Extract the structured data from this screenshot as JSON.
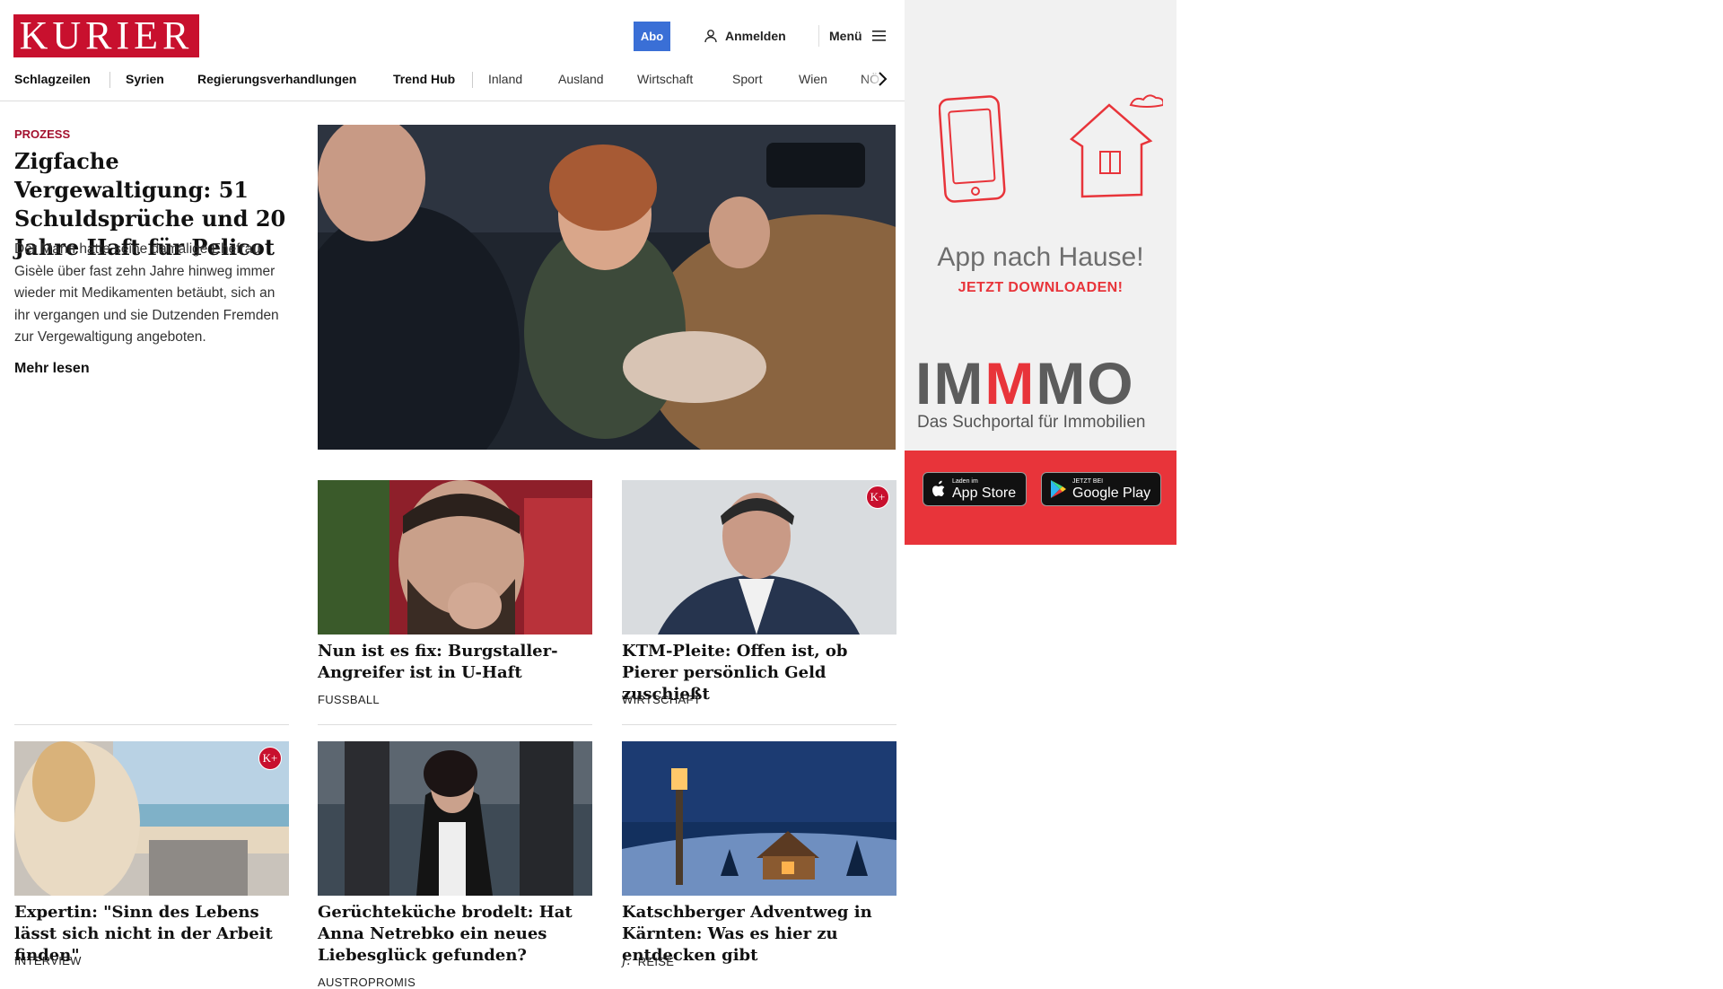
{
  "header": {
    "logo_text": "KURIER",
    "abo_label": "Abo",
    "login_label": "Anmelden",
    "menu_label": "Menü",
    "brand_color": "#c8102e",
    "abo_color": "#3a6fd6"
  },
  "nav": {
    "items": [
      "Schlagzeilen",
      "Syrien",
      "Regierungsverhandlungen",
      "Trend Hub",
      "Inland",
      "Ausland",
      "Wirtschaft",
      "Sport",
      "Wien",
      "NÖ"
    ]
  },
  "lead": {
    "kicker": "PROZESS",
    "title": "Zigfache Vergewaltigung: 51 Schuldsprüche und 20 Jahre Haft für Pelicot",
    "teaser": "Der Mann hatte seine damalige Ehefrau Gisèle über fast zehn Jahre hinweg immer wieder mit Medikamenten betäubt, sich an ihr vergangen und sie Dutzenden Fremden zur Vergewaltigung angeboten.",
    "more_label": "Mehr lesen"
  },
  "cards": [
    {
      "title": "Nun ist es fix: Burgstaller-Angrei­fer ist in U-Haft",
      "tag": "FUSSBALL",
      "premium": false
    },
    {
      "title": "KTM-Pleite: Offen ist, ob Pierer persönlich Geld zuschießt",
      "tag": "WIRTSCHAFT",
      "premium": true,
      "badge": "K+"
    },
    {
      "title": "Expertin: \"Sinn des Lebens lässt sich nicht in der Arbeit finden\"",
      "tag": "INTERVIEW",
      "premium": true,
      "badge": "K+"
    },
    {
      "title": "Gerüchteküche brodelt: Hat Anna Netrebko ein neues Liebesglück gefunden?",
      "tag": "AUSTROPROMIS",
      "premium": false
    },
    {
      "title": "Katschberger Adventweg in Kärn­ten: Was es hier zu entdecken gibt",
      "tag": "REISE",
      "tag_prefix": "f.",
      "premium": false
    }
  ],
  "ad": {
    "title": "App nach Hause!",
    "cta": "JETZT DOWNLOADEN!",
    "brand_a": "IM",
    "brand_m": "M",
    "brand_b": "MO",
    "brand_tagline": "Das Suchportal für Immobilien",
    "appstore_small": "Laden im",
    "appstore_big": "App Store",
    "googleplay_small": "JETZT BEI",
    "googleplay_big": "Google Play",
    "accent_color": "#e8343a"
  }
}
